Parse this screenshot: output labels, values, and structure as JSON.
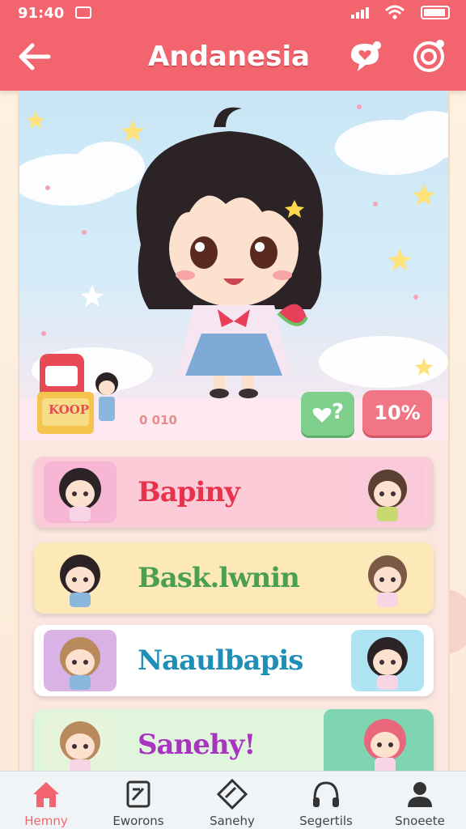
{
  "status_bar": {
    "time": "91:40"
  },
  "header": {
    "title": "Andanesia",
    "back_icon": "arrow-left-icon",
    "chat_icon": "heart-chat-icon",
    "settings_icon": "target-settings-icon"
  },
  "hero": {
    "counter": "0 010",
    "sign_text": "KOOP",
    "like_icon": "heart-question-icon",
    "like_label": "?",
    "percent_label": "10%"
  },
  "cards": [
    {
      "label": "Bapiny",
      "color": "#e8334d",
      "bg": "#fbcbd8"
    },
    {
      "label": "Bask.lwnin",
      "color": "#4aa04f",
      "bg": "#fde9b7"
    },
    {
      "label": "Naaulbapis",
      "color": "#1f8fb7",
      "bg": "#ffffff"
    },
    {
      "label": "Sanehy!",
      "color": "#a934c2",
      "bg": "#dff5dc"
    }
  ],
  "bottom_nav": [
    {
      "label": "Hemny",
      "icon": "home-icon",
      "active": true
    },
    {
      "label": "Eworons",
      "icon": "document-icon",
      "active": false
    },
    {
      "label": "Sanehy",
      "icon": "diamond-icon",
      "active": false
    },
    {
      "label": "Segertils",
      "icon": "headphones-icon",
      "active": false
    },
    {
      "label": "Snoeete",
      "icon": "profile-icon",
      "active": false
    }
  ],
  "colors": {
    "header": "#f2656f",
    "accent_pink": "#f27585",
    "accent_green": "#7fcf8d"
  }
}
